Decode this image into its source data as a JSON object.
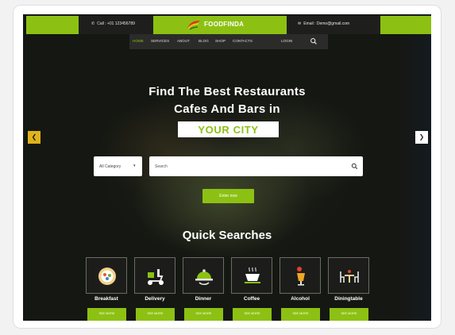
{
  "topbar": {
    "phone": "Call : +01 123456789",
    "email": "Email : Demo@gmail.com",
    "logo": "FOODFINDA"
  },
  "nav": {
    "items": [
      "HOME",
      "SERVICES",
      "ABOUT",
      "BLOG",
      "SHOP",
      "CONTACTS"
    ],
    "login": "LOGIN",
    "active": "HOME"
  },
  "hero": {
    "line1": "Find The Best Restaurants",
    "line2": "Cafes And Bars in",
    "highlight": "YOUR CITY"
  },
  "search": {
    "category": "All Category",
    "placeholder": "Search",
    "submit_label": "Enter now"
  },
  "quick": {
    "title": "Quick Searches",
    "button_label": "SEE MORE",
    "categories": [
      {
        "name": "Breakfast",
        "icon": "breakfast-plate-icon"
      },
      {
        "name": "Delivery",
        "icon": "delivery-scooter-icon"
      },
      {
        "name": "Dinner",
        "icon": "dinner-cloche-icon"
      },
      {
        "name": "Coffee",
        "icon": "coffee-cup-icon"
      },
      {
        "name": "Alcohol",
        "icon": "cocktail-glass-icon"
      },
      {
        "name": "Diningtable",
        "icon": "dining-table-icon"
      }
    ]
  },
  "colors": {
    "accent": "#8cc113",
    "background": "#151712",
    "arrow_left": "#e0b21a"
  }
}
